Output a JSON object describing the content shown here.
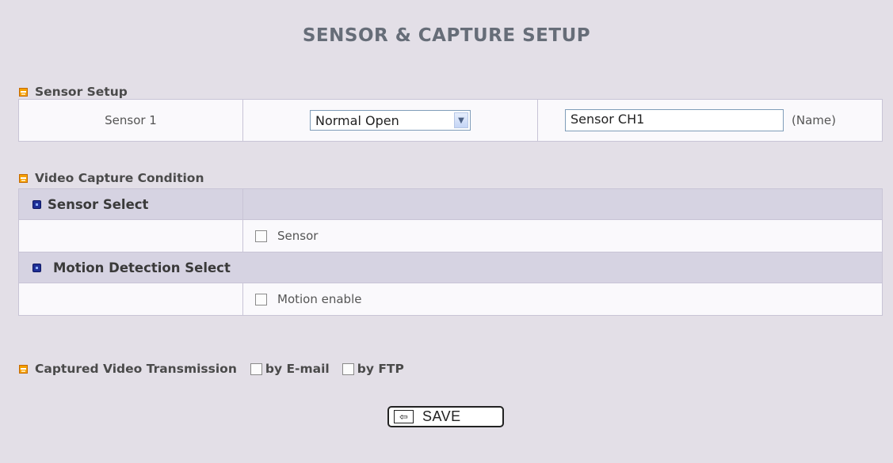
{
  "page": {
    "title": "SENSOR & CAPTURE SETUP"
  },
  "sensor_setup": {
    "heading": "Sensor Setup",
    "sensor_label": "Sensor 1",
    "sensor_mode": "Normal Open",
    "sensor_name_value": "Sensor CH1",
    "name_hint": "(Name)"
  },
  "video_capture": {
    "heading": "Video Capture Condition",
    "sensor_select": {
      "title": "Sensor Select",
      "option_label": "Sensor",
      "checked": false
    },
    "motion_select": {
      "title": "Motion Detection Select",
      "option_label": "Motion enable",
      "checked": false
    }
  },
  "transmission": {
    "heading": "Captured Video Transmission",
    "email_label": "by E-mail",
    "ftp_label": "by FTP"
  },
  "save_button": {
    "label": "SAVE",
    "icon": "arrow-left-icon"
  },
  "icons": {
    "section": "section-bullet-icon",
    "subsection": "subsection-bullet-icon"
  },
  "colors": {
    "background": "#e3dfe7",
    "band": "#d6d3e2",
    "title": "#666d78",
    "section_icon": "#f5a000",
    "subsection_icon": "#1f2f95"
  }
}
